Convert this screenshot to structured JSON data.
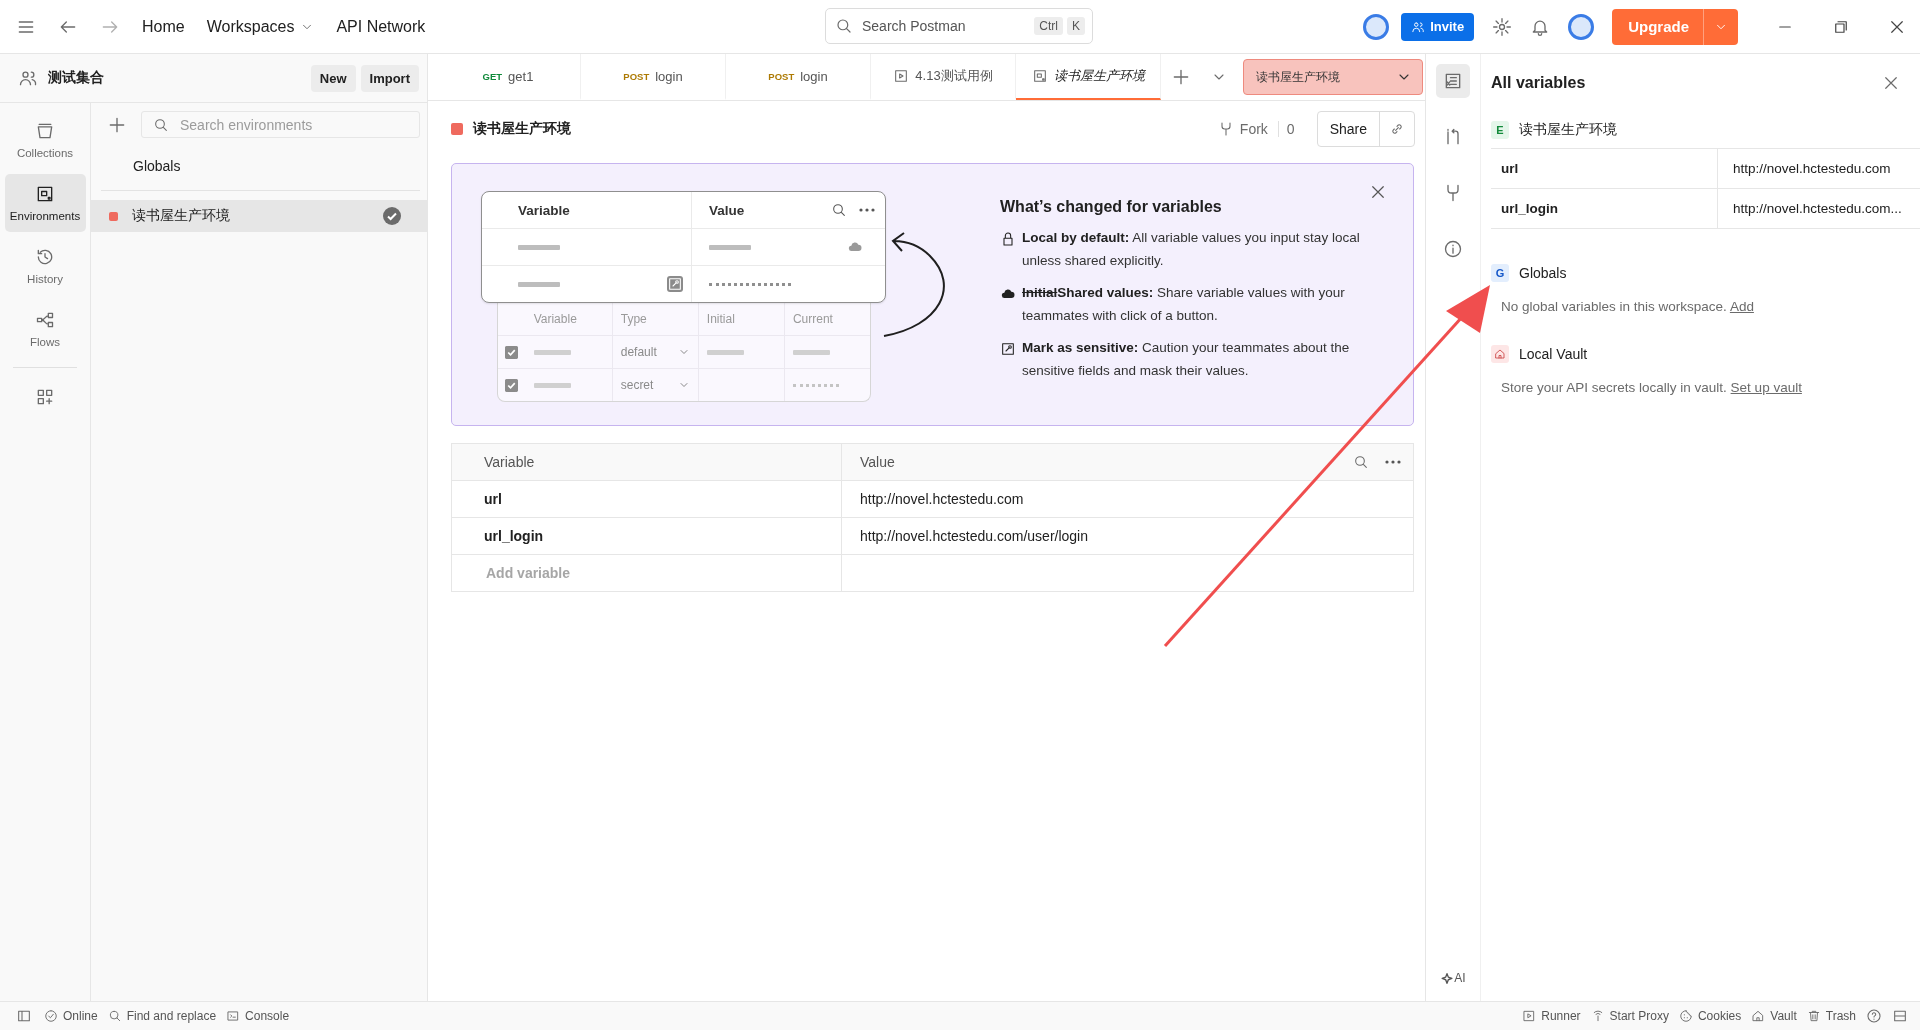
{
  "topbar": {
    "nav": [
      "Home",
      "Workspaces",
      "API Network"
    ],
    "search": {
      "placeholder": "Search Postman",
      "keys": [
        "Ctrl",
        "K"
      ]
    },
    "invite": "Invite",
    "upgrade": "Upgrade"
  },
  "workspace": {
    "name": "测试集合",
    "buttons": [
      "New",
      "Import"
    ]
  },
  "rail": [
    {
      "kind": "collections",
      "label": "Collections",
      "selected": false
    },
    {
      "kind": "environments",
      "label": "Environments",
      "selected": true
    },
    {
      "kind": "history",
      "label": "History",
      "selected": false
    },
    {
      "kind": "flows",
      "label": "Flows",
      "selected": false
    }
  ],
  "env_list": {
    "search": {
      "placeholder": "Search environments"
    },
    "globals": "Globals",
    "items": [
      {
        "name": "读书屋生产环境",
        "color": "#ef6a5e",
        "selected": true,
        "active": true
      }
    ]
  },
  "tabs": [
    {
      "kind": "request",
      "method": "GET",
      "label": "get1",
      "selected": false,
      "preview": false
    },
    {
      "kind": "request",
      "method": "POST",
      "label": "login",
      "selected": false,
      "preview": false
    },
    {
      "kind": "request",
      "method": "POST",
      "label": "login",
      "selected": false,
      "preview": false
    },
    {
      "kind": "runner",
      "label": "4.13测试用例",
      "selected": false,
      "preview": false
    },
    {
      "kind": "environment",
      "label": "读书屋生产环境",
      "selected": true,
      "preview": true
    }
  ],
  "env_selector": "读书屋生产环境",
  "environment": {
    "name": "读书屋生产环境",
    "color": "#ef6a5e",
    "fork": "Fork",
    "fork_count": "0",
    "share": "Share"
  },
  "banner": {
    "title": "What’s changed for variables",
    "illustration": {
      "top_columns": [
        "Variable",
        "Value"
      ],
      "bottom_columns": [
        "Variable",
        "Type",
        "Initial",
        "Current"
      ],
      "rows": [
        {
          "checked": true,
          "type": "default"
        },
        {
          "checked": true,
          "type": "secret"
        }
      ]
    },
    "points": [
      {
        "kind": "lock",
        "text": "**Local by default:** All variable values you input stay local unless shared explicitly."
      },
      {
        "kind": "cloud",
        "struck": "Initial",
        "text": "**Shared values:** Share variable values with your teammates with click of a button."
      },
      {
        "kind": "sensitive",
        "text": "**Mark as sensitive:** Caution your teammates about the sensitive fields and mask their values."
      }
    ]
  },
  "table": {
    "columns": [
      "Variable",
      "Value"
    ],
    "rows": [
      {
        "variable": "url",
        "value": "http://novel.hctestedu.com"
      },
      {
        "variable": "url_login",
        "value": "http://novel.hctestedu.com/user/login"
      }
    ],
    "add_placeholder": "Add variable"
  },
  "panel": {
    "title": "All variables",
    "environment": {
      "badge": "E",
      "name": "读书屋生产环境",
      "rows": [
        {
          "name": "url",
          "value": "http://novel.hctestedu.com"
        },
        {
          "name": "url_login",
          "value": "http://novel.hctestedu.com..."
        }
      ]
    },
    "globals": {
      "badge": "G",
      "name": "Globals",
      "text": "No global variables in this workspace.",
      "link": "Add"
    },
    "vault": {
      "name": "Local Vault",
      "text": "Store your API secrets locally in vault.",
      "link": "Set up vault"
    },
    "ai_label": "AI"
  },
  "status_bar": {
    "left": [
      {
        "kind": "online",
        "label": "Online"
      },
      {
        "kind": "find",
        "label": "Find and replace"
      },
      {
        "kind": "console",
        "label": "Console"
      }
    ],
    "right": [
      {
        "kind": "runner",
        "label": "Runner"
      },
      {
        "kind": "proxy",
        "label": "Start Proxy"
      },
      {
        "kind": "cookies",
        "label": "Cookies"
      },
      {
        "kind": "vault",
        "label": "Vault"
      },
      {
        "kind": "trash",
        "label": "Trash"
      }
    ]
  }
}
